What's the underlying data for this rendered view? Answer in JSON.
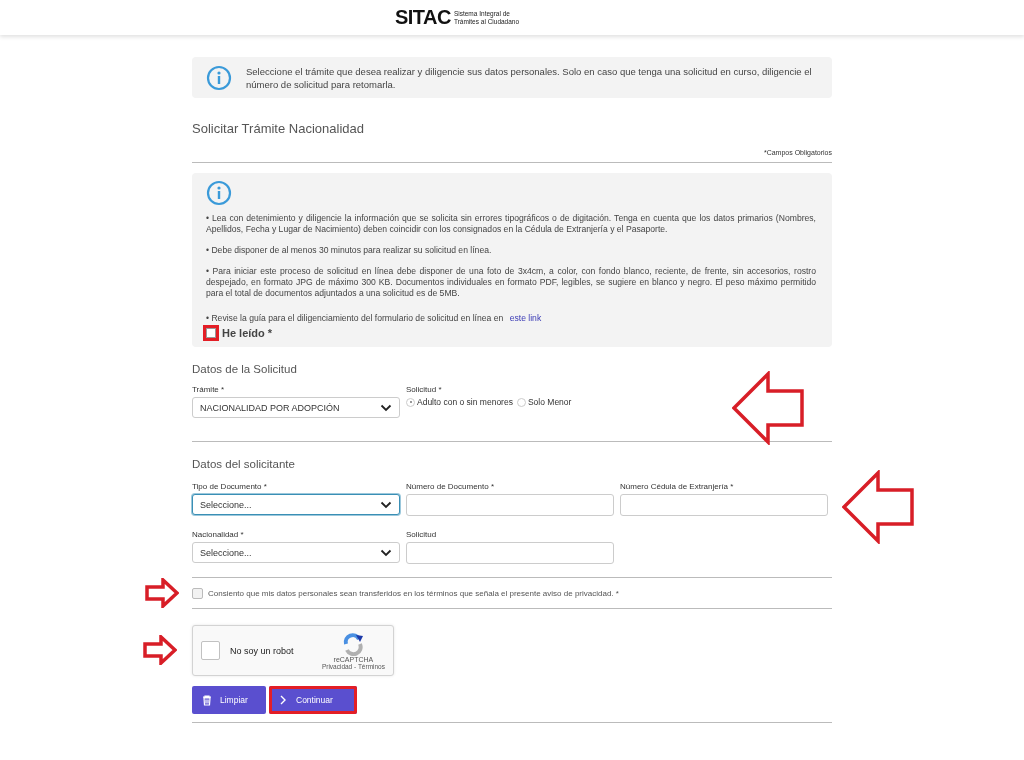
{
  "header": {
    "logo": "SITAC",
    "logo_subtitle_1": "Sistema Integral de",
    "logo_subtitle_2": "Trámites al Ciudadano"
  },
  "intro_notice": {
    "text": "Seleccione el trámite que desea realizar y diligencie sus datos personales. Solo en caso que tenga una solicitud en curso, diligencie el número de solicitud para retomarla."
  },
  "form_title": "Solicitar Trámite Nacionalidad",
  "required_note": "*Campos Obligatorios",
  "instructions": {
    "paragraphs": [
      "• Lea con detenimiento y diligencie la información que se solicita sin errores tipográficos o de digitación. Tenga en cuenta que los datos primarios (Nombres, Apellidos, Fecha y Lugar de Nacimiento) deben coincidir con los consignados en la Cédula de Extranjería y el Pasaporte.",
      "• Debe disponer de al menos 30 minutos para realizar su solicitud en línea.",
      "• Para iniciar este proceso de solicitud en línea debe disponer de una foto de 3x4cm, a color, con fondo blanco, reciente, de frente, sin accesorios, rostro despejado, en formato JPG de máximo 300 KB. Documentos individuales en formato PDF, legibles, se sugiere en blanco y negro. El peso máximo permitido para el total de documentos adjuntados a una solicitud es de 5MB."
    ],
    "guide_text": "• Revise la guía para el diligenciamiento del formulario de solicitud en línea en",
    "guide_link": "este link",
    "read_checkbox": {
      "label": "He leído *",
      "checked": false,
      "highlighted": true
    }
  },
  "request_section": {
    "title": "Datos de la Solicitud",
    "arrow_marked": true,
    "tramite": {
      "label": "Trámite *",
      "value": "NACIONALIDAD POR ADOPCIÓN"
    },
    "solicitud": {
      "label": "Solicitud *",
      "options": [
        {
          "label": "Adulto con o sin menores",
          "selected": true
        },
        {
          "label": "Solo Menor",
          "selected": false
        }
      ]
    }
  },
  "applicant_section": {
    "title": "Datos del solicitante",
    "arrow_marked": true,
    "fields": [
      {
        "kind": "select",
        "label": "Tipo de Documento *",
        "value": "Seleccione...",
        "focused": true
      },
      {
        "kind": "text",
        "label": "Número de Documento *",
        "focused": false
      },
      {
        "kind": "text",
        "label": "Número Cédula de Extranjería *",
        "focused": false
      },
      {
        "kind": "select",
        "label": "Nacionalidad *",
        "value": "Seleccione...",
        "focused": false
      },
      {
        "kind": "text",
        "label": "Solicitud",
        "focused": false
      }
    ]
  },
  "consent": {
    "label": "Consiento que mis datos personales sean transferidos en los términos que señala el presente aviso de privacidad. *",
    "checked": false,
    "arrow_marked": true
  },
  "captcha": {
    "label": "No soy un robot",
    "brand": "reCAPTCHA",
    "links": "Privacidad - Términos",
    "checked": false,
    "arrow_marked": true
  },
  "buttons": [
    {
      "kind": "clear",
      "label": "Limpiar",
      "highlighted": false
    },
    {
      "kind": "continue",
      "label": "Continuar",
      "highlighted": true
    }
  ]
}
